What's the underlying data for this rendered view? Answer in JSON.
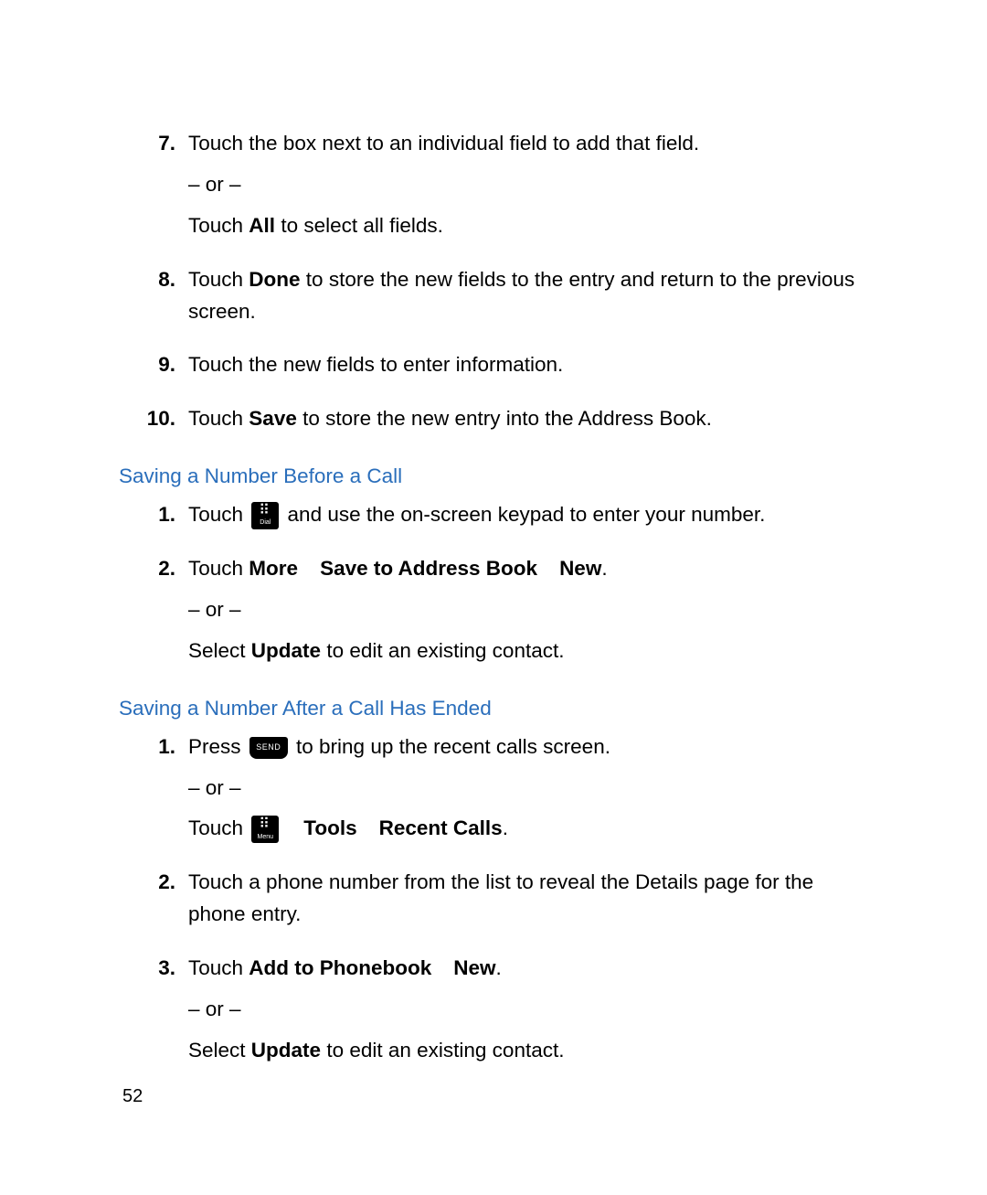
{
  "page_number": "52",
  "top_items": [
    {
      "num": "7.",
      "l1a": "Touch the box next to an individual field to add that field.",
      "or": "– or –",
      "l2a": "Touch ",
      "l2b": "All",
      "l2c": " to select all fields."
    },
    {
      "num": "8.",
      "l1a": "Touch ",
      "l1b": "Done",
      "l1c": " to store the new fields to the entry and return to the previous screen."
    },
    {
      "num": "9.",
      "l1a": "Touch the new fields to enter information."
    },
    {
      "num": "10.",
      "l1a": "Touch ",
      "l1b": "Save",
      "l1c": " to store the new entry into the Address Book."
    }
  ],
  "section1": {
    "title": "Saving a Number Before a Call",
    "items": [
      {
        "num": "1.",
        "l1a": "Touch ",
        "l1b": " and use the on-screen keypad to enter your number."
      },
      {
        "num": "2.",
        "l1a": "Touch ",
        "l1b": "More",
        "l1c": "Save to Address Book",
        "l1d": "New",
        "l1e": ".",
        "or": "– or –",
        "l2a": "Select ",
        "l2b": "Update",
        "l2c": " to edit an existing contact."
      }
    ]
  },
  "section2": {
    "title": "Saving a Number After a Call Has Ended",
    "items": [
      {
        "num": "1.",
        "l1a": "Press ",
        "l1b": " to bring up the recent calls screen.",
        "or": "– or –",
        "l2a": "Touch ",
        "l2b": "Tools",
        "l2c": "Recent Calls",
        "l2d": "."
      },
      {
        "num": "2.",
        "l1a": "Touch a phone number from the list to reveal the Details page for the phone entry."
      },
      {
        "num": "3.",
        "l1a": "Touch ",
        "l1b": "Add to Phonebook",
        "l1c": "New",
        "l1d": ".",
        "or": "– or –",
        "l2a": "Select ",
        "l2b": "Update",
        "l2c": " to edit an existing contact."
      }
    ]
  }
}
